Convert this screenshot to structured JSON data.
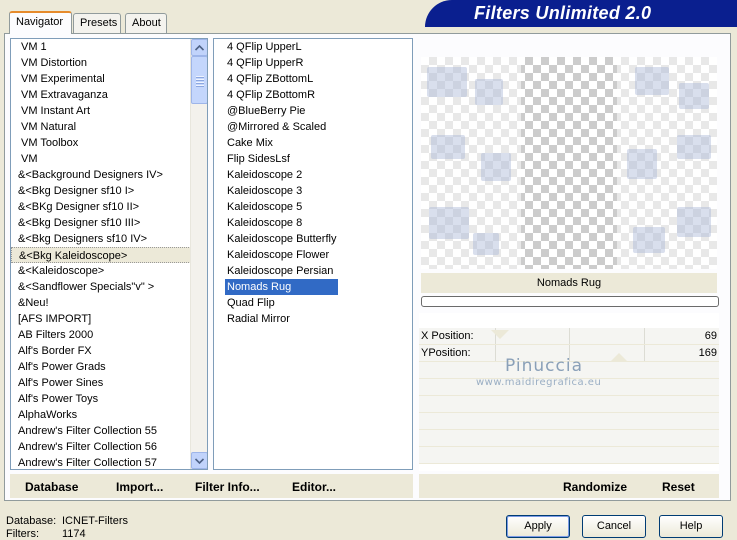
{
  "banner": {
    "title": "Filters Unlimited 2.0"
  },
  "tabs": [
    {
      "label": "Navigator"
    },
    {
      "label": "Presets"
    },
    {
      "label": "About"
    }
  ],
  "categories": [
    "VM 1",
    "VM Distortion",
    "VM Experimental",
    "VM Extravaganza",
    "VM Instant Art",
    "VM Natural",
    "VM Toolbox",
    "VM",
    "&<Background Designers IV>",
    "&<Bkg Designer sf10 I>",
    "&<BKg Designer sf10 II>",
    "&<Bkg Designer sf10 III>",
    "&<Bkg Designers sf10 IV>",
    "&<Bkg Kaleidoscope>",
    "&<Kaleidoscope>",
    "&<Sandflower Specials\"v\" >",
    "&Neu!",
    "[AFS IMPORT]",
    "AB Filters 2000",
    "Alf's Border FX",
    "Alf's Power Grads",
    "Alf's Power Sines",
    "Alf's Power Toys",
    "AlphaWorks",
    "Andrew's Filter Collection 55",
    "Andrew's Filter Collection 56",
    "Andrew's Filter Collection 57"
  ],
  "filters": [
    "4 QFlip UpperL",
    "4 QFlip UpperR",
    "4 QFlip ZBottomL",
    "4 QFlip ZBottomR",
    "@BlueBerry Pie",
    "@Mirrored & Scaled",
    "Cake Mix",
    "Flip SidesLsf",
    "Kaleidoscope 2",
    "Kaleidoscope 3",
    "Kaleidoscope 5",
    "Kaleidoscope 8",
    "Kaleidoscope Butterfly",
    "Kaleidoscope Flower",
    "Kaleidoscope Persian",
    "Nomads Rug",
    "Quad Flip",
    "Radial Mirror"
  ],
  "selected_filter_name": "Nomads Rug",
  "params": [
    {
      "label": "X Position:",
      "value": "69"
    },
    {
      "label": "YPosition:",
      "value": "169"
    }
  ],
  "watermark": {
    "name": "Pinuccia",
    "site": "www.maidiregrafica.eu"
  },
  "toolbar": {
    "database": "Database",
    "import": "Import...",
    "filter_info": "Filter Info...",
    "editor": "Editor...",
    "randomize": "Randomize",
    "reset": "Reset"
  },
  "status": {
    "database_label": "Database:",
    "database_value": "ICNET-Filters",
    "filters_label": "Filters:",
    "filters_value": "1174"
  },
  "buttons": {
    "apply": "Apply",
    "cancel": "Cancel",
    "help": "Help"
  }
}
